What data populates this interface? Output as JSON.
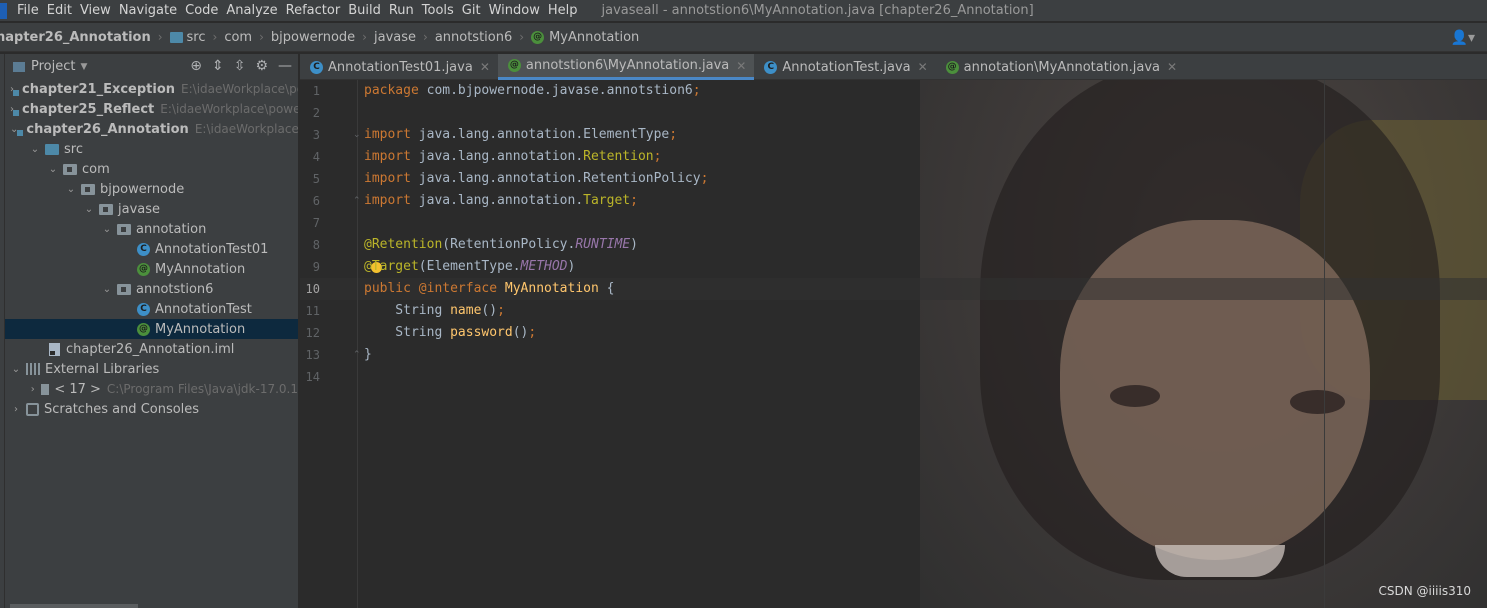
{
  "menu": {
    "items": [
      "File",
      "Edit",
      "View",
      "Navigate",
      "Code",
      "Analyze",
      "Refactor",
      "Build",
      "Run",
      "Tools",
      "Git",
      "Window",
      "Help"
    ],
    "window_title": "javaseall - annotstion6\\MyAnnotation.java [chapter26_Annotation]"
  },
  "breadcrumb": [
    "hapter26_Annotation",
    "src",
    "com",
    "bjpowernode",
    "javase",
    "annotstion6",
    "MyAnnotation"
  ],
  "project_panel": {
    "title": "Project",
    "tree": [
      {
        "label": "chapter21_Exception",
        "path": "E:\\idaeWorkplace\\po"
      },
      {
        "label": "chapter25_Reflect",
        "path": "E:\\idaeWorkplace\\powe"
      },
      {
        "label": "chapter26_Annotation",
        "path": "E:\\idaeWorkplace\\p"
      },
      {
        "label": "src"
      },
      {
        "label": "com"
      },
      {
        "label": "bjpowernode"
      },
      {
        "label": "javase"
      },
      {
        "label": "annotation"
      },
      {
        "label": "AnnotationTest01"
      },
      {
        "label": "MyAnnotation"
      },
      {
        "label": "annotstion6"
      },
      {
        "label": "AnnotationTest"
      },
      {
        "label": "MyAnnotation"
      },
      {
        "label": "chapter26_Annotation.iml"
      },
      {
        "label": "External Libraries"
      },
      {
        "label": "< 17 >",
        "path": "C:\\Program Files\\Java\\jdk-17.0.1"
      },
      {
        "label": "Scratches and Consoles"
      }
    ]
  },
  "tabs": [
    {
      "label": "AnnotationTest01.java",
      "icon": "class"
    },
    {
      "label": "annotstion6\\MyAnnotation.java",
      "icon": "annotation"
    },
    {
      "label": "AnnotationTest.java",
      "icon": "class"
    },
    {
      "label": "annotation\\MyAnnotation.java",
      "icon": "annotation"
    }
  ],
  "editor": {
    "line_numbers": [
      "1",
      "2",
      "3",
      "4",
      "5",
      "6",
      "7",
      "8",
      "9",
      "10",
      "11",
      "12",
      "13",
      "14"
    ],
    "current_line": 10,
    "code": {
      "l1_kw": "package",
      "l1_rest": " com.bjpowernode.javase.annotstion6",
      "l1_semi": ";",
      "import_kw": "import",
      "l3_pkg": " java.lang.annotation.",
      "l3_name": "ElementType",
      "l4_name": "Retention",
      "l5_name": "RetentionPolicy",
      "l6_name": "Target",
      "semi": ";",
      "l8_ann": "@Retention",
      "l8_open": "(RetentionPolicy.",
      "l8_const": "RUNTIME",
      "l8_close": ")",
      "l9_ann": "@Target",
      "l9_open": "(ElementType.",
      "l9_const": "METHOD",
      "l9_close": ")",
      "l10_public": "public ",
      "l10_interface": "@interface ",
      "l10_name": "MyAnnotation",
      "l10_brace": " {",
      "l11_type": "    String ",
      "l11_name": "name",
      "l11_parens": "()",
      "l12_type": "    String ",
      "l12_name": "password",
      "l12_parens": "()",
      "l13": "}"
    }
  },
  "watermark": "CSDN @iiiis310",
  "colors": {
    "keyword": "#cc7832",
    "annotation": "#bbb529",
    "method": "#ffc66d",
    "constant": "#9876aa",
    "text": "#a9b7c6"
  }
}
